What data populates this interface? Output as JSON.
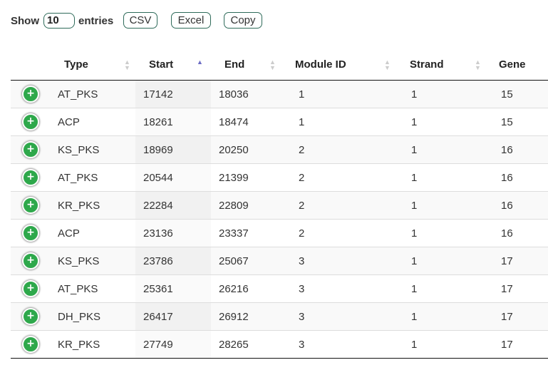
{
  "length_menu": {
    "show_label": "Show",
    "value": "10",
    "entries_label": "entries"
  },
  "buttons": {
    "csv": "CSV",
    "excel": "Excel",
    "copy": "Copy"
  },
  "columns": [
    "Type",
    "Start",
    "End",
    "Module ID",
    "Strand",
    "Gene"
  ],
  "sort": {
    "column": "Start",
    "direction": "ascending"
  },
  "expand_icon": "plus-circle-icon",
  "colors": {
    "expand_button": "#2ea84b",
    "button_border": "#2f6b5a",
    "sort_active": "#6c6cc4"
  },
  "rows": [
    {
      "type": "AT_PKS",
      "start": "17142",
      "end": "18036",
      "module_id": "1",
      "strand": "1",
      "gene": "15"
    },
    {
      "type": "ACP",
      "start": "18261",
      "end": "18474",
      "module_id": "1",
      "strand": "1",
      "gene": "15"
    },
    {
      "type": "KS_PKS",
      "start": "18969",
      "end": "20250",
      "module_id": "2",
      "strand": "1",
      "gene": "16"
    },
    {
      "type": "AT_PKS",
      "start": "20544",
      "end": "21399",
      "module_id": "2",
      "strand": "1",
      "gene": "16"
    },
    {
      "type": "KR_PKS",
      "start": "22284",
      "end": "22809",
      "module_id": "2",
      "strand": "1",
      "gene": "16"
    },
    {
      "type": "ACP",
      "start": "23136",
      "end": "23337",
      "module_id": "2",
      "strand": "1",
      "gene": "16"
    },
    {
      "type": "KS_PKS",
      "start": "23786",
      "end": "25067",
      "module_id": "3",
      "strand": "1",
      "gene": "17"
    },
    {
      "type": "AT_PKS",
      "start": "25361",
      "end": "26216",
      "module_id": "3",
      "strand": "1",
      "gene": "17"
    },
    {
      "type": "DH_PKS",
      "start": "26417",
      "end": "26912",
      "module_id": "3",
      "strand": "1",
      "gene": "17"
    },
    {
      "type": "KR_PKS",
      "start": "27749",
      "end": "28265",
      "module_id": "3",
      "strand": "1",
      "gene": "17"
    }
  ]
}
